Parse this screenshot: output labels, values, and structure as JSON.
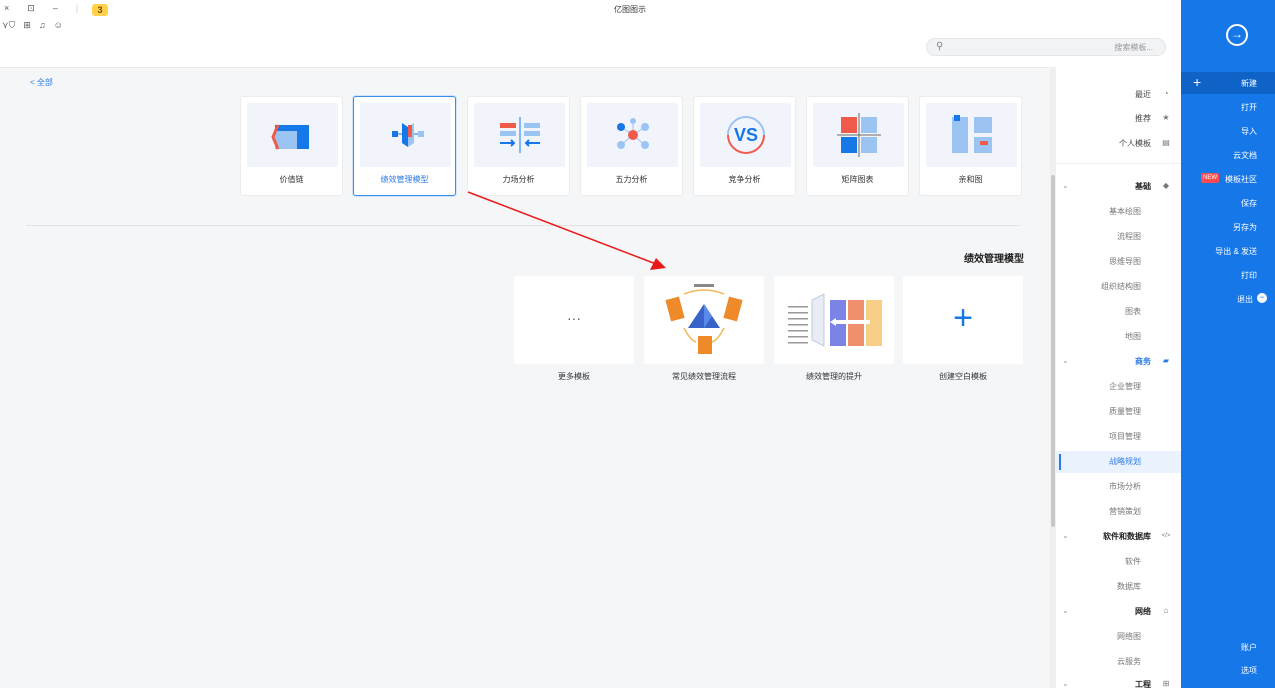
{
  "titlebar": {
    "left_glyphs": [
      "×",
      "⊡",
      "–",
      "|"
    ],
    "left_row2": [
      "⋎⛉",
      "⊞",
      "♫",
      "☺"
    ],
    "badge": "3",
    "title": "亿图图示"
  },
  "search": {
    "placeholder": "搜索模板..."
  },
  "main": {
    "back_label": "< 全部",
    "categories": [
      {
        "label": "价值链"
      },
      {
        "label": "绩效管理模型"
      },
      {
        "label": "力场分析"
      },
      {
        "label": "五力分析"
      },
      {
        "label": "竞争分析"
      },
      {
        "label": "矩阵图表"
      },
      {
        "label": "亲和图"
      }
    ],
    "section_title": "绩效管理模型",
    "templates": [
      {
        "label": "更多模板",
        "thumb_text": "···"
      },
      {
        "label": "常见绩效管理流程"
      },
      {
        "label": "绩效管理的提升"
      },
      {
        "label": "创建空白模板",
        "thumb_text": "+"
      }
    ]
  },
  "right_sidebar": {
    "top_items": [
      {
        "label": "最近",
        "icon": "clock-icon",
        "glyph": "◔"
      },
      {
        "label": "推荐",
        "icon": "star-icon",
        "glyph": "★"
      },
      {
        "label": "个人模板",
        "icon": "person-icon",
        "glyph": "▤"
      }
    ],
    "groups": [
      {
        "label": "基础",
        "icon": "shape-icon",
        "glyph": "◆",
        "expanded": true,
        "items": [
          "基本绘图",
          "流程图",
          "思维导图",
          "组织结构图",
          "图表",
          "地图"
        ]
      },
      {
        "label": "商务",
        "icon": "briefcase-icon",
        "glyph": "▰",
        "expanded": true,
        "items": [
          "企业管理",
          "质量管理",
          "项目管理",
          "战略规划",
          "市场分析",
          "营销策划"
        ],
        "active_index": 3
      },
      {
        "label": "软件和数据库",
        "icon": "code-icon",
        "glyph": "</>",
        "expanded": true,
        "items": [
          "软件",
          "数据库"
        ]
      },
      {
        "label": "网络",
        "icon": "network-icon",
        "glyph": "⌂",
        "expanded": true,
        "items": [
          "网络图",
          "云服务"
        ]
      },
      {
        "label": "工程",
        "icon": "engineering-icon",
        "glyph": "⊞",
        "expanded": false,
        "items": []
      }
    ]
  },
  "nav": {
    "top_icon": "→",
    "items": [
      {
        "label": "新建",
        "active": true
      },
      {
        "label": "打开"
      },
      {
        "label": "导入"
      },
      {
        "label": "云文档"
      },
      {
        "label": "模板社区",
        "badge": "NEW"
      },
      {
        "label": "保存"
      },
      {
        "label": "另存为"
      },
      {
        "label": "导出 & 发送"
      },
      {
        "label": "打印"
      },
      {
        "label": "退出"
      }
    ],
    "bottom": [
      "账户",
      "选项"
    ]
  },
  "colors": {
    "accent": "#1677e9",
    "selected_border": "#3a8ee6",
    "arrow": "#e81a1a"
  }
}
